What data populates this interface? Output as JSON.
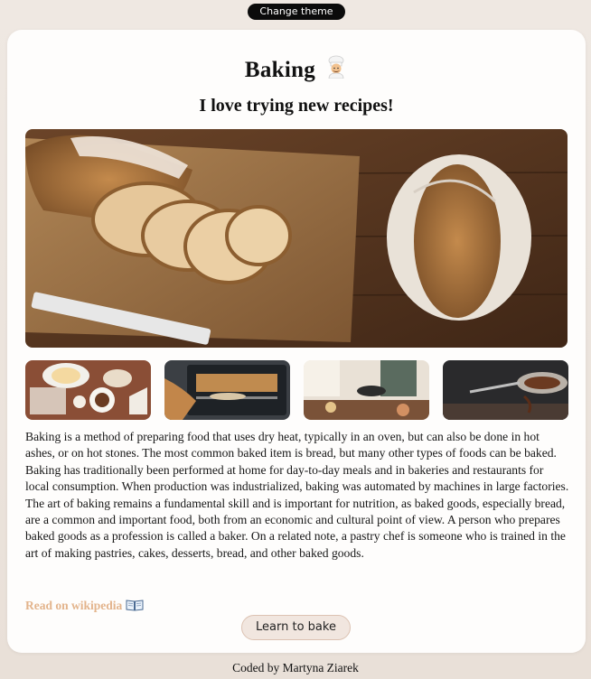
{
  "header": {
    "theme_button_label": "Change theme"
  },
  "card": {
    "title": "Baking",
    "title_icon": "chef-emoji-icon",
    "subtitle": "I love trying new recipes!",
    "hero_image": "bread-loaves-on-cutting-board",
    "thumbnails": [
      "baking-ingredients-photo",
      "oven-baking-photo",
      "kitchen-cooking-photo",
      "chocolate-whisk-photo"
    ],
    "paragraph": "Baking is a method of preparing food that uses dry heat, typically in an oven, but can also be done in hot ashes, or on hot stones. The most common baked item is bread, but many other types of foods can be baked. Baking has traditionally been performed at home for day-to-day meals and in bakeries and restaurants for local consumption. When production was industrialized, baking was automated by machines in large factories. The art of baking remains a fundamental skill and is important for nutrition, as baked goods, especially bread, are a common and important food, both from an economic and cultural point of view. A person who prepares baked goods as a profession is called a baker. On a related note, a pastry chef is someone who is trained in the art of making pastries, cakes, desserts, bread, and other baked goods.",
    "wiki_link_label": "Read on wikipedia",
    "wiki_icon": "open-book-icon",
    "learn_button_label": "Learn to bake"
  },
  "footer": {
    "credit": "Coded by Martyna Ziarek"
  },
  "colors": {
    "background": "#efe8e2",
    "card": "#fefdfc",
    "link": "#e3b48c",
    "button_bg": "#f1e6df",
    "button_border": "#dcc2b2"
  }
}
